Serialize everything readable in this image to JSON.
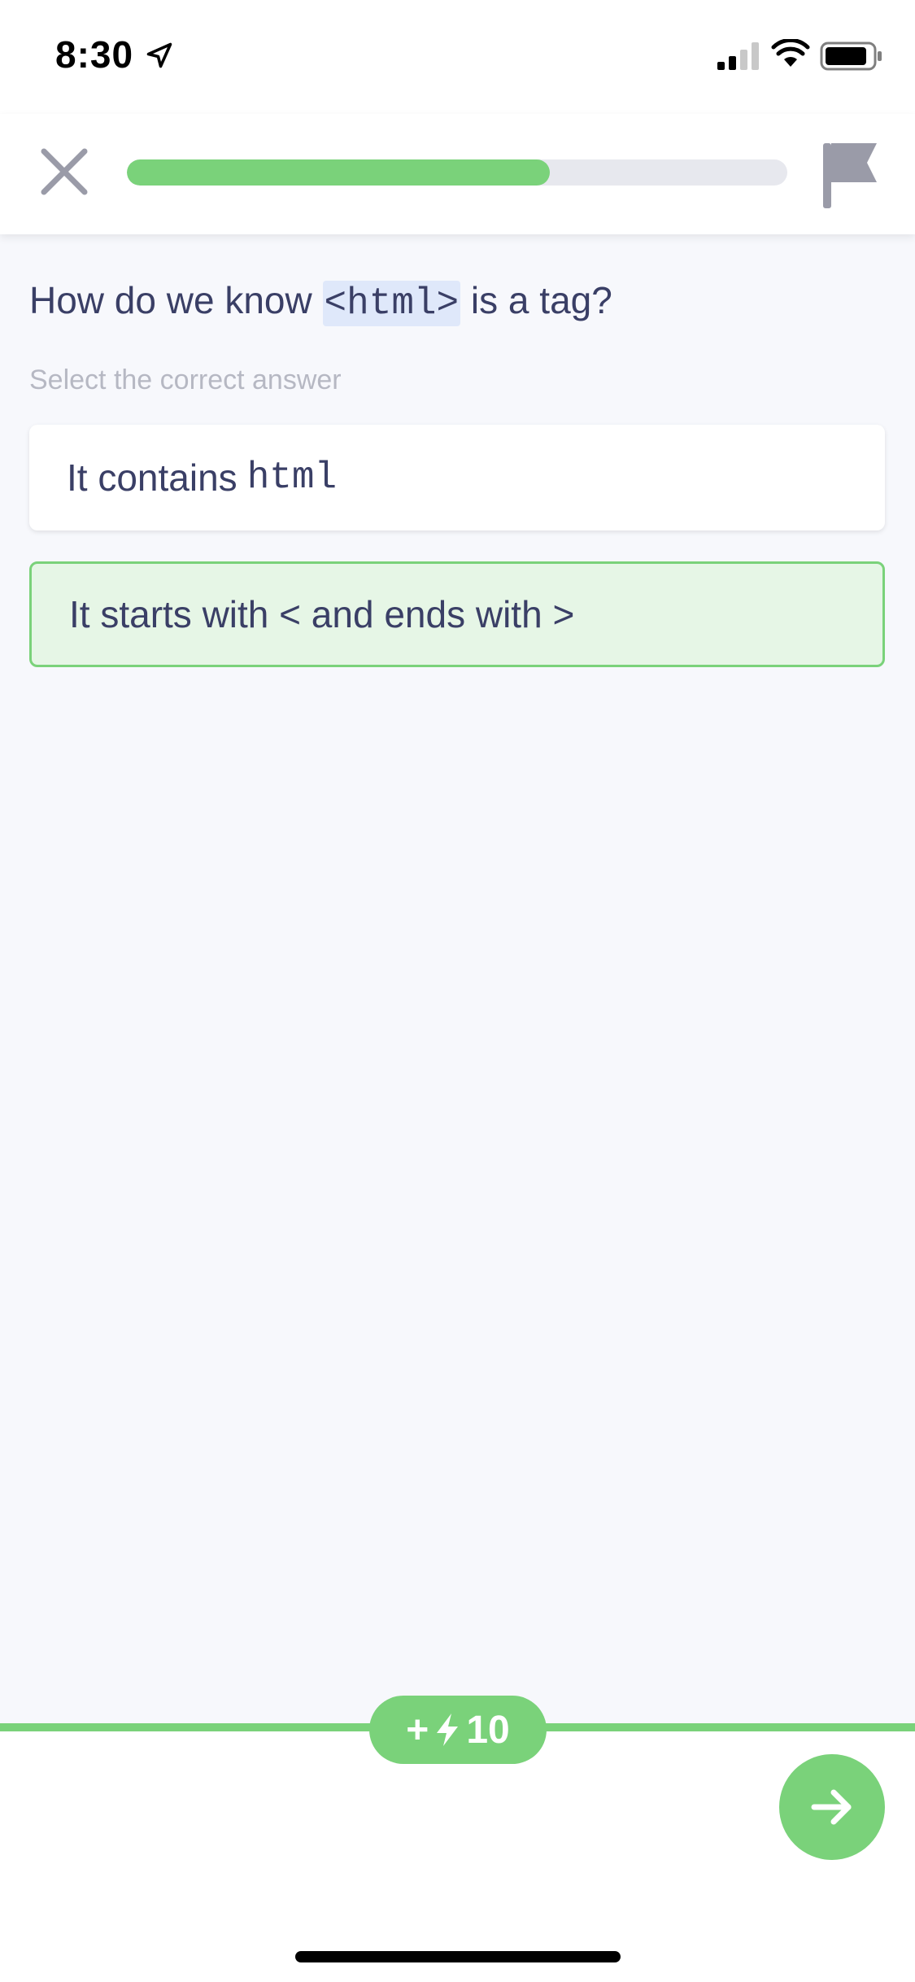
{
  "status_bar": {
    "time": "8:30"
  },
  "header": {
    "progress": 0.64
  },
  "question": {
    "prefix": "How do we know ",
    "code": "<html>",
    "suffix": " is a tag?"
  },
  "instruction": "Select the correct answer",
  "options": [
    {
      "text": "It contains",
      "code": "html"
    },
    {
      "text": "It starts with < and ends with >"
    }
  ],
  "reward": {
    "plus": "+",
    "amount": "10"
  },
  "colors": {
    "accent": "#7ad27a",
    "text": "#3a3f66",
    "selected_bg": "#e6f6e6",
    "code_highlight": "#dfe8fa"
  }
}
